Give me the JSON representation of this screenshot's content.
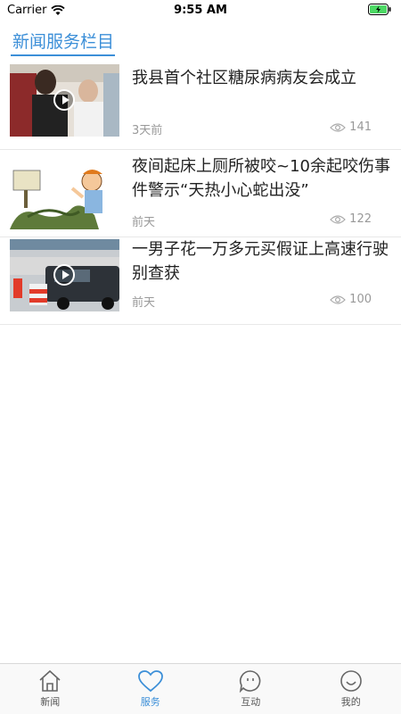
{
  "status_bar": {
    "carrier": "Carrier",
    "time": "9:55 AM"
  },
  "header": {
    "title": "新闻服务栏目"
  },
  "news": [
    {
      "title": "我县首个社区糖尿病病友会成立",
      "time": "3天前",
      "views": "141",
      "has_video": true
    },
    {
      "title": "夜间起床上厕所被咬~10余起咬伤事件警示“天热小心蛇出没”",
      "time": "前天",
      "views": "122",
      "has_video": false
    },
    {
      "title": "一男子花一万多元买假证上高速行驶别查获",
      "time": "前天",
      "views": "100",
      "has_video": true
    }
  ],
  "tabbar": {
    "tabs": [
      {
        "label": "新闻",
        "icon": "home-icon",
        "active": false
      },
      {
        "label": "服务",
        "icon": "heart-icon",
        "active": true
      },
      {
        "label": "互动",
        "icon": "chat-icon",
        "active": false
      },
      {
        "label": "我的",
        "icon": "smile-icon",
        "active": false
      }
    ]
  },
  "colors": {
    "accent": "#3c8fd8",
    "muted": "#999999",
    "text": "#222222"
  }
}
